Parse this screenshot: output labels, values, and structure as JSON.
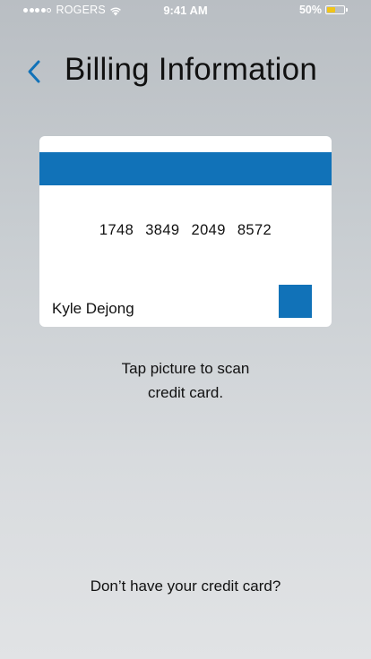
{
  "status_bar": {
    "carrier": "ROGERS",
    "time": "9:41 AM",
    "battery_percent": "50%",
    "battery_level": 0.5,
    "signal_bars_filled": 4,
    "signal_bars_total": 5
  },
  "header": {
    "title": "Billing Information",
    "back_icon": "chevron-left-icon"
  },
  "card": {
    "number_groups": [
      "1748",
      "3849",
      "2049",
      "8572"
    ],
    "holder_name": "Kyle Dejong"
  },
  "instruction": {
    "line1": "Tap picture to scan",
    "line2": "credit card."
  },
  "footer": {
    "no_card_link": "Don’t have your credit card?"
  },
  "colors": {
    "accent": "#1172b8",
    "battery": "#f0c419"
  }
}
